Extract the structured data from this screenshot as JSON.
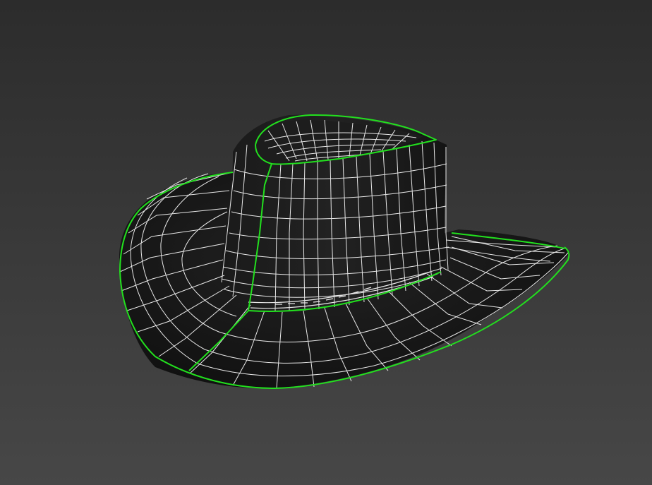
{
  "viewport": {
    "background_top": "#2c2c2c",
    "background_bottom": "#474747"
  },
  "model": {
    "object": "hat",
    "display_mode": "wireframe-on-shaded",
    "surface_color": "#161616",
    "wire_color": "#e8e8e8",
    "selection_color": "#22e01e"
  }
}
